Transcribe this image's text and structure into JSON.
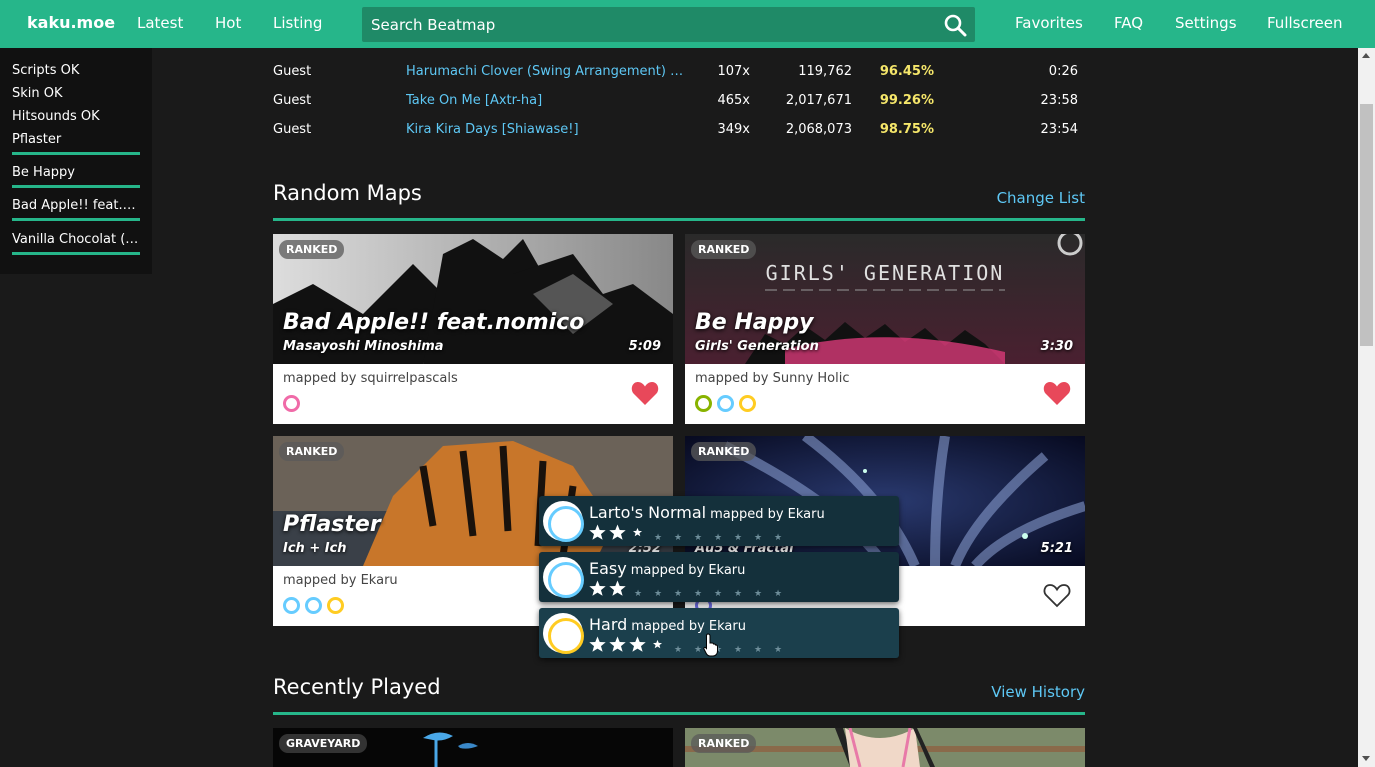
{
  "nav": {
    "brand": "kaku.moe",
    "links": [
      "Latest",
      "Hot",
      "Listing"
    ],
    "search_placeholder": "Search Beatmap",
    "right_links": [
      "Favorites",
      "FAQ",
      "Settings",
      "Fullscreen"
    ]
  },
  "sidebar": {
    "status": [
      "Scripts  OK",
      "Skin  OK",
      "Hitsounds  OK"
    ],
    "items": [
      "Pflaster",
      "Be Happy",
      "Bad Apple!! feat.nomico",
      "Vanilla Chocolat (Speed Up Ver.)"
    ]
  },
  "plays": [
    {
      "player": "Guest",
      "map": "Harumachi Clover (Swing Arrangement) [Dear Friends]",
      "combo": "107x",
      "score": "119,762",
      "acc": "96.45%",
      "time": "0:26"
    },
    {
      "player": "Guest",
      "map": "Take On Me [Axtr-ha]",
      "combo": "465x",
      "score": "2,017,671",
      "acc": "99.26%",
      "time": "23:58"
    },
    {
      "player": "Guest",
      "map": "Kira Kira Days [Shiawase!]",
      "combo": "349x",
      "score": "2,068,073",
      "acc": "98.75%",
      "time": "23:54"
    }
  ],
  "random": {
    "title": "Random Maps",
    "link": "Change List",
    "cards": [
      {
        "status": "RANKED",
        "title": "Bad Apple!! feat.nomico",
        "artist": "Masayoshi Minoshima",
        "length": "5:09",
        "mapper": "mapped by squirrelpascals",
        "diff_colors": [
          "#f06ba8"
        ],
        "favorited": true
      },
      {
        "status": "RANKED",
        "title": "Be Happy",
        "artist": "Girls' Generation",
        "length": "3:30",
        "mapper": "mapped by Sunny Holic",
        "diff_colors": [
          "#88b300",
          "#66ccff",
          "#ffcc22"
        ],
        "favorited": true
      },
      {
        "status": "RANKED",
        "title": "Pflaster",
        "artist": "Ich + Ich",
        "length": "2:52",
        "mapper": "mapped by Ekaru",
        "diff_colors": [
          "#66ccff",
          "#66ccff",
          "#ffcc22"
        ],
        "favorited": false
      },
      {
        "status": "RANKED",
        "title": "",
        "artist": "Au5 & Fractal",
        "length": "5:21",
        "mapper": "",
        "diff_colors": [
          "#6e6ee8"
        ],
        "favorited": false
      }
    ],
    "banner_text": "GIRLS' GENERATION"
  },
  "difficulty_popup": [
    {
      "name": "Larto's Normal",
      "mapper": "mapped by Ekaru",
      "stars": 2.3,
      "color": "#66ccff"
    },
    {
      "name": "Easy",
      "mapper": "mapped by Ekaru",
      "stars": 2.0,
      "color": "#66ccff"
    },
    {
      "name": "Hard",
      "mapper": "mapped by Ekaru",
      "stars": 3.4,
      "color": "#ffcc22"
    }
  ],
  "recent": {
    "title": "Recently Played",
    "link": "View History",
    "cards": [
      {
        "status": "GRAVEYARD"
      },
      {
        "status": "RANKED"
      }
    ]
  }
}
